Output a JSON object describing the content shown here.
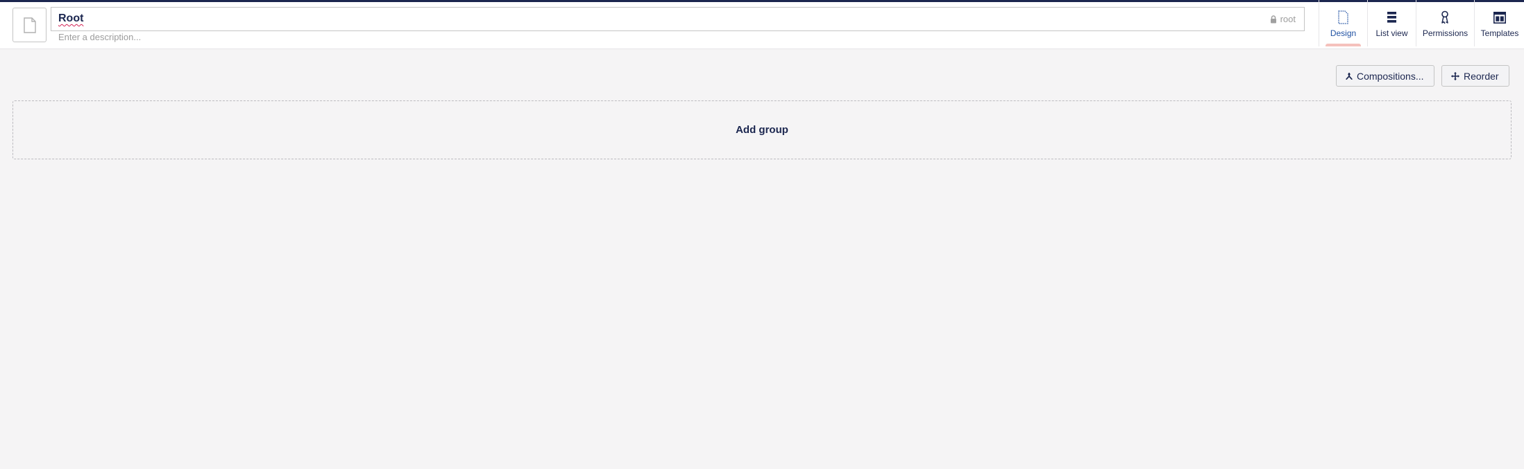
{
  "header": {
    "document_icon": "document-icon",
    "name_value": "Root",
    "alias_icon": "lock-icon",
    "alias_value": "root",
    "description_placeholder": "Enter a description..."
  },
  "nav": {
    "items": [
      {
        "label": "Design",
        "icon": "document-outline-icon",
        "active": true
      },
      {
        "label": "List view",
        "icon": "list-icon",
        "active": false
      },
      {
        "label": "Permissions",
        "icon": "permissions-icon",
        "active": false
      },
      {
        "label": "Templates",
        "icon": "templates-icon",
        "active": false
      }
    ]
  },
  "toolbar": {
    "compositions_label": "Compositions...",
    "compositions_icon": "merge-icon",
    "reorder_label": "Reorder",
    "reorder_icon": "move-icon"
  },
  "main": {
    "add_group_label": "Add group"
  },
  "colors": {
    "primary": "#1b264f",
    "active_tab_text": "#2152a3",
    "active_tab_indicator": "#f5c1bc",
    "background": "#f5f4f5",
    "spellcheck_underline": "#d42054"
  }
}
